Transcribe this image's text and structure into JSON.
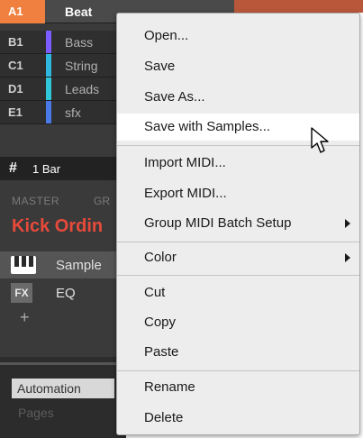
{
  "groups": [
    {
      "slot": "A1",
      "name": "Beat",
      "color": "#f08040",
      "active": true
    },
    {
      "slot": "B1",
      "name": "Bass",
      "color": "#7a5cff",
      "active": false
    },
    {
      "slot": "C1",
      "name": "String",
      "color": "#30b8e0",
      "active": false
    },
    {
      "slot": "D1",
      "name": "Leads",
      "color": "#30c8d8",
      "active": false
    },
    {
      "slot": "E1",
      "name": "sfx",
      "color": "#4a7ae8",
      "active": false
    }
  ],
  "pattern_length": {
    "hash": "#",
    "value": "1 Bar"
  },
  "section": {
    "master_label": "MASTER",
    "group_label": "GR"
  },
  "sound_name": "Kick Ordin",
  "slots": [
    {
      "icon": "piano-keys-icon",
      "label": "Sample"
    },
    {
      "icon": "fx-icon",
      "badge": "FX",
      "label": "EQ"
    }
  ],
  "add_symbol": "+",
  "bottom": {
    "automation_label": "Automation",
    "pages_label": "Pages"
  },
  "context_menu": {
    "sections": [
      [
        "Open...",
        "Save",
        "Save As...",
        "Save with Samples..."
      ],
      [
        "Import MIDI...",
        "Export MIDI...",
        "Group MIDI Batch Setup"
      ],
      [
        "Color"
      ],
      [
        "Cut",
        "Copy",
        "Paste"
      ],
      [
        "Rename",
        "Delete"
      ]
    ],
    "hovered": "Save with Samples...",
    "submenu_items": [
      "Group MIDI Batch Setup",
      "Color"
    ]
  },
  "colors": {
    "accent": "#f08040",
    "sound_name": "#e84a3a",
    "menu_bg": "#ededed"
  }
}
